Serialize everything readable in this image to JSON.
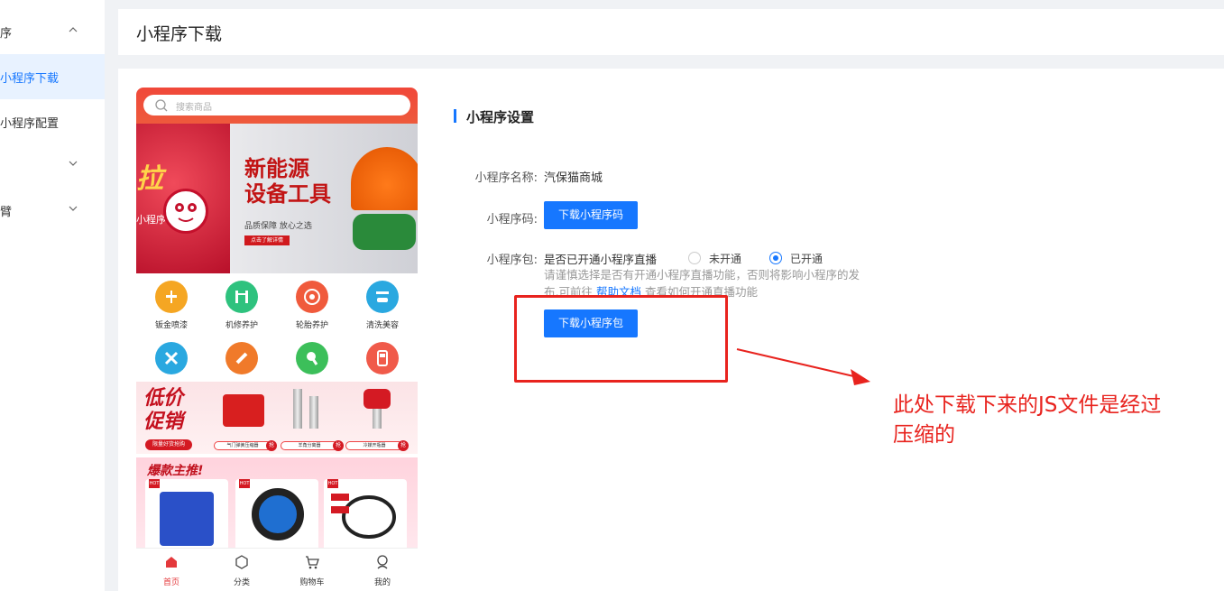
{
  "sidebar": {
    "items": [
      {
        "label": "序",
        "expanded": true
      },
      {
        "label": "小程序下载",
        "active": true
      },
      {
        "label": "小程序配置"
      },
      {
        "label": ""
      },
      {
        "label": "臂"
      }
    ]
  },
  "header": {
    "title": "小程序下载"
  },
  "preview": {
    "search_placeholder": "搜索商品",
    "banner": {
      "left_text": "拉",
      "left_sub": "小程序",
      "headline_1": "新能源",
      "headline_2": "设备工具",
      "sub": "品质保障 放心之选",
      "button": "点击了解详情"
    },
    "icons": [
      {
        "label": "钣金喷漆",
        "color": "#f5a623",
        "icon": "spray-icon"
      },
      {
        "label": "机修养护",
        "color": "#2ec27e",
        "icon": "lift-icon"
      },
      {
        "label": "轮胎养护",
        "color": "#f05a3c",
        "icon": "tire-icon"
      },
      {
        "label": "清洗美容",
        "color": "#2aa8e0",
        "icon": "wash-icon"
      },
      {
        "label": "",
        "color": "#2aa8e0",
        "icon": "tools-icon"
      },
      {
        "label": "",
        "color": "#f07a2a",
        "icon": "grinder-icon"
      },
      {
        "label": "",
        "color": "#3cbf5a",
        "icon": "gun-icon"
      },
      {
        "label": "",
        "color": "#f05a4a",
        "icon": "meter-icon"
      }
    ],
    "promo1": {
      "line1": "低价",
      "line2": "促销",
      "tag": "限量好货抢购",
      "items": [
        {
          "label": "气门弹簧压缩器",
          "badge": "抢"
        },
        {
          "label": "羊角分离器",
          "badge": "抢"
        },
        {
          "label": "冷媒开瓶器",
          "badge": "抢"
        }
      ]
    },
    "promo2": {
      "title": "爆款主推!",
      "hot_label": "HOT"
    },
    "tabbar": [
      {
        "label": "首页",
        "icon": "home-icon",
        "active": true
      },
      {
        "label": "分类",
        "icon": "category-icon"
      },
      {
        "label": "购物车",
        "icon": "cart-icon"
      },
      {
        "label": "我的",
        "icon": "user-icon"
      }
    ]
  },
  "settings": {
    "section_title": "小程序设置",
    "name_label": "小程序名称:",
    "name_value": "汽保猫商城",
    "code_label": "小程序码:",
    "code_button": "下载小程序码",
    "package_label": "小程序包:",
    "live_question": "是否已开通小程序直播",
    "option_no": "未开通",
    "option_yes": "已开通",
    "selected": "已开通",
    "hint_1": "请谨慎选择是否有开通小程序直播功能，否则将影响小程序的发",
    "hint_2_pre": "布,可前往",
    "hint_link": "帮助文档",
    "hint_2_post": "查看如何开通直播功能",
    "package_button": "下载小程序包"
  },
  "annotation": {
    "text_line1": "此处下载下来的JS文件是经过",
    "text_line2": "压缩的",
    "color": "#e8231e"
  }
}
